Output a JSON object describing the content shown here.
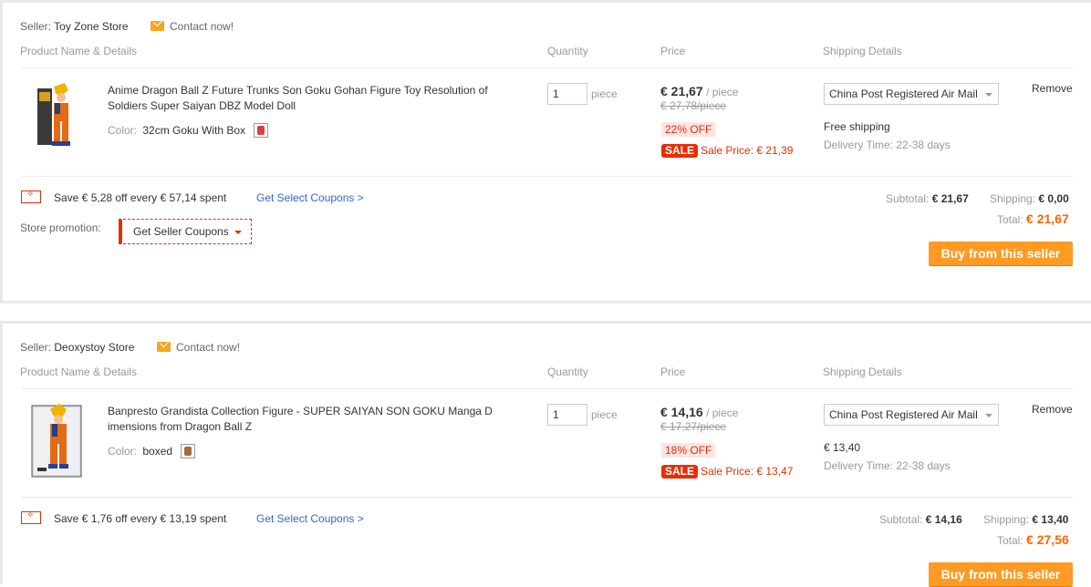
{
  "colors": {
    "accent": "#e62e04",
    "buy_button": "#ff9a22",
    "link": "#3366cc",
    "total": "#ff6600"
  },
  "headers": {
    "product": "Product Name & Details",
    "quantity": "Quantity",
    "price": "Price",
    "shipping": "Shipping Details"
  },
  "sellers": [
    {
      "seller_label": "Seller:",
      "seller_name": "Toy Zone Store",
      "contact": "Contact now!",
      "product": {
        "title": "Anime Dragon Ball Z Future Trunks Son Goku Gohan Figure Toy Resolution of Soldiers Super Saiyan DBZ Model Doll",
        "color_label": "Color:",
        "color_value": "32cm Goku With Box"
      },
      "quantity": "1",
      "quantity_unit": "piece",
      "price": "€ 21,67",
      "price_unit": "/ piece",
      "original_price": "€ 27,78/piece",
      "discount": "22% OFF",
      "sale_badge": "SALE",
      "sale_price": "Sale Price: € 21,39",
      "shipping_method": "China Post Registered Air Mail",
      "shipping_cost": "Free shipping",
      "delivery_time": "Delivery Time: 22-38 days",
      "remove": "Remove",
      "coupon_text": "Save € 5,28 off every € 57,14 spent",
      "coupon_link": "Get Select Coupons >",
      "store_promotion_label": "Store promotion:",
      "seller_coupons": "Get Seller Coupons",
      "subtotal_label": "Subtotal:",
      "subtotal": "€ 21,67",
      "shipping_label": "Shipping:",
      "shipping_total": "€ 0,00",
      "total_label": "Total:",
      "total": "€ 21,67",
      "buy_button": "Buy from this seller"
    },
    {
      "seller_label": "Seller:",
      "seller_name": "Deoxystoy Store",
      "contact": "Contact now!",
      "product": {
        "title": "Banpresto Grandista Collection Figure - SUPER SAIYAN SON GOKU Manga D imensions from Dragon Ball Z",
        "color_label": "Color:",
        "color_value": "boxed"
      },
      "quantity": "1",
      "quantity_unit": "piece",
      "price": "€ 14,16",
      "price_unit": "/ piece",
      "original_price": "€ 17,27/piece",
      "discount": "18% OFF",
      "sale_badge": "SALE",
      "sale_price": "Sale Price: € 13,47",
      "shipping_method": "China Post Registered Air Mail",
      "shipping_cost": "€ 13,40",
      "delivery_time": "Delivery Time: 22-38 days",
      "remove": "Remove",
      "coupon_text": "Save € 1,76 off every € 13,19 spent",
      "coupon_link": "Get Select Coupons >",
      "subtotal_label": "Subtotal:",
      "subtotal": "€ 14,16",
      "shipping_label": "Shipping:",
      "shipping_total": "€ 13,40",
      "total_label": "Total:",
      "total": "€ 27,56",
      "buy_button": "Buy from this seller"
    }
  ]
}
